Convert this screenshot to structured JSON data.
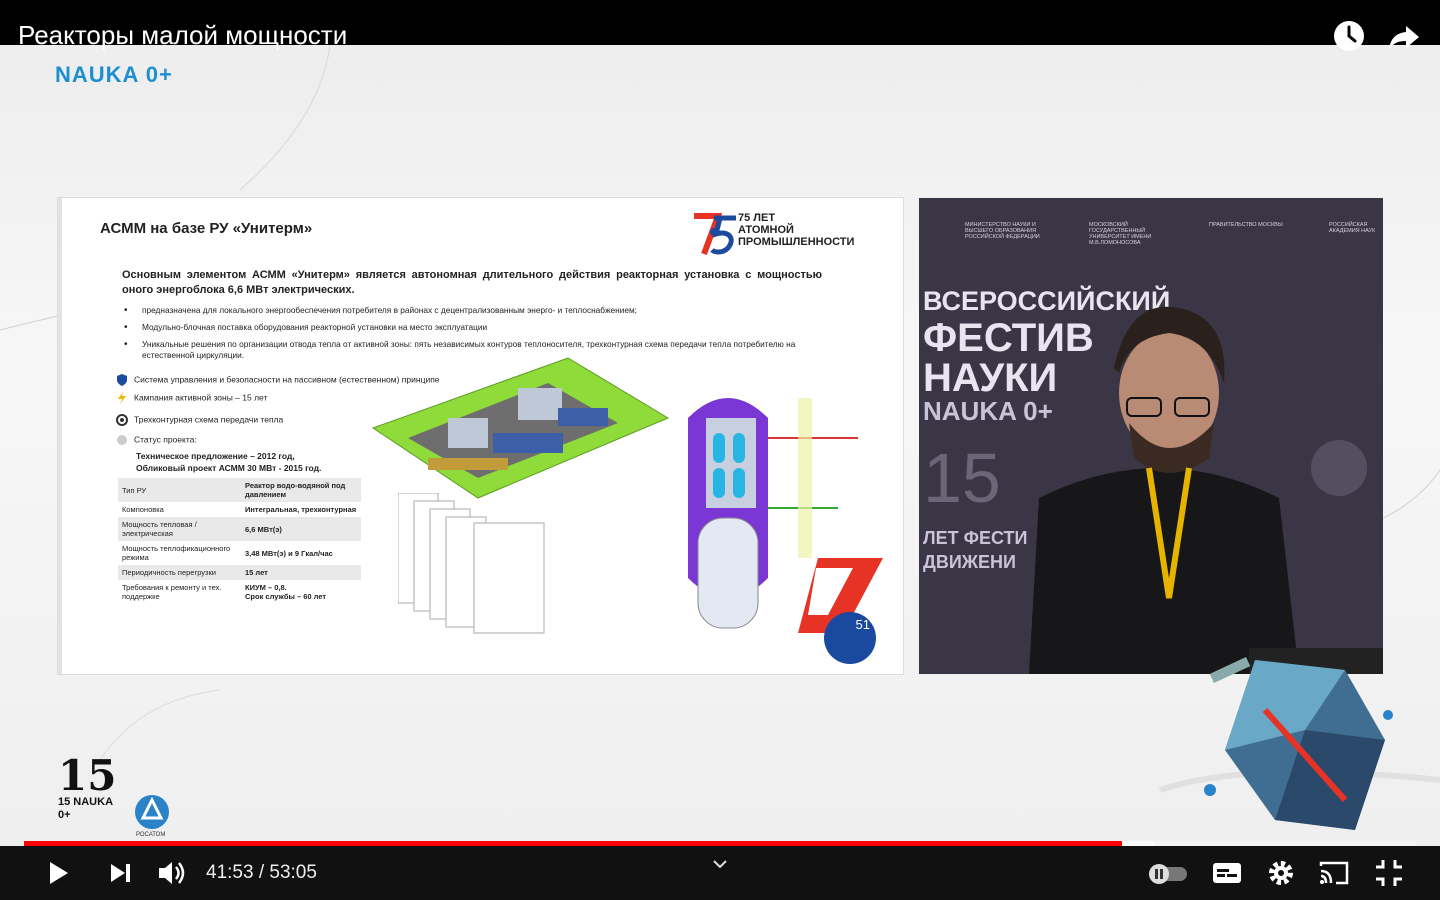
{
  "header": {
    "title": "Реакторы малой мощности",
    "watch_later_icon": "clock-icon",
    "share_icon": "share-arrow-icon"
  },
  "brand": {
    "top_logo": "NAUKA 0+",
    "rosatom": "РОСАТОМ",
    "logo15": "15 NAUKA 0+"
  },
  "slide": {
    "title": "АСММ на базе РУ «Унитерм»",
    "anniversary": "75 ЛЕТ\nАТОМНОЙ\nПРОМЫШЛЕННОСТИ",
    "lead": "Основным элементом АСММ «Унитерм» является автономная длительного действия реакторная установка с мощностью оного энергоблока 6,6 МВт электрических.",
    "bullets": [
      "предназначена для локального энергообеспечения потребителя в районах с децентрализованным энерго- и теплоснабжением;",
      "Модульно-блочная поставка оборудования реакторной установки на место эксплуатации",
      "Уникальные решения по организации отвода тепла от активной зоны: пять независимых контуров теплоносителя, трехконтурная схема передачи тепла потребителю на естественной циркуляции."
    ],
    "features": [
      "Система управления и безопасности на пассивном (естественном) принципе",
      "Кампания активной зоны – 15 лет",
      "Трехконтурная схема передачи тепла",
      "Статус проекта:"
    ],
    "status_lines": [
      "Техническое предложение – 2012 год,",
      "Обликовый проект АСММ 30 МВт - 2015 год."
    ],
    "spec": [
      [
        "Тип РУ",
        "Реактор водо-водяной под давлением"
      ],
      [
        "Компоновка",
        "Интегральная, трехконтурная"
      ],
      [
        "Мощность тепловая / электрическая",
        "6,6 МВт(э)"
      ],
      [
        "Мощность теплофикационного режима",
        "3,48 МВт(э) и 9 Гкал/час"
      ],
      [
        "Периодичность перегрузки",
        "15 лет"
      ],
      [
        "Требования к ремонту и тех. поддержке",
        "КИУМ – 0,8.\nСрок службы – 60 лет"
      ]
    ],
    "page_number": "51"
  },
  "speaker": {
    "lines": [
      "ВСЕРОССИЙСКИЙ",
      "ФЕСТИВ",
      "НАУКИ",
      "NAUKA 0+",
      "15",
      "ЛЕТ ФЕСТИ",
      "ДВИЖЕНИ"
    ],
    "partners": [
      "МИНИСТЕРСТВО НАУКИ И ВЫСШЕГО ОБРАЗОВАНИЯ РОССИЙСКОЙ ФЕДЕРАЦИИ",
      "МОСКОВСКИЙ ГОСУДАРСТВЕННЫЙ УНИВЕРСИТЕТ ИМЕНИ М.В.ЛОМОНОСОВА",
      "ПРАВИТЕЛЬСТВО МОСКВЫ",
      "РОССИЙСКАЯ АКАДЕМИЯ НАУК"
    ]
  },
  "player": {
    "time": "41:53 / 53:05",
    "progress": 0.789,
    "buffered": 0.812,
    "accent": "#ff0000"
  }
}
